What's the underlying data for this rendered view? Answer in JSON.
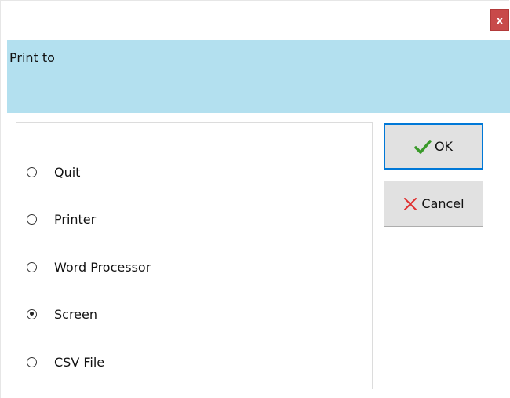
{
  "window": {
    "close_label": "x"
  },
  "header": {
    "title": "Print to"
  },
  "options": [
    {
      "label": "Quit",
      "checked": false
    },
    {
      "label": "Printer",
      "checked": false
    },
    {
      "label": "Word Processor",
      "checked": false
    },
    {
      "label": "Screen",
      "checked": true
    },
    {
      "label": "CSV File",
      "checked": false
    }
  ],
  "buttons": {
    "ok_label": "OK",
    "cancel_label": "Cancel"
  },
  "colors": {
    "header_bg": "#b3e0ef",
    "close_bg": "#c84a4a",
    "ok_check": "#3a9a2a",
    "cancel_x": "#e03030",
    "focus_border": "#0078d7"
  }
}
